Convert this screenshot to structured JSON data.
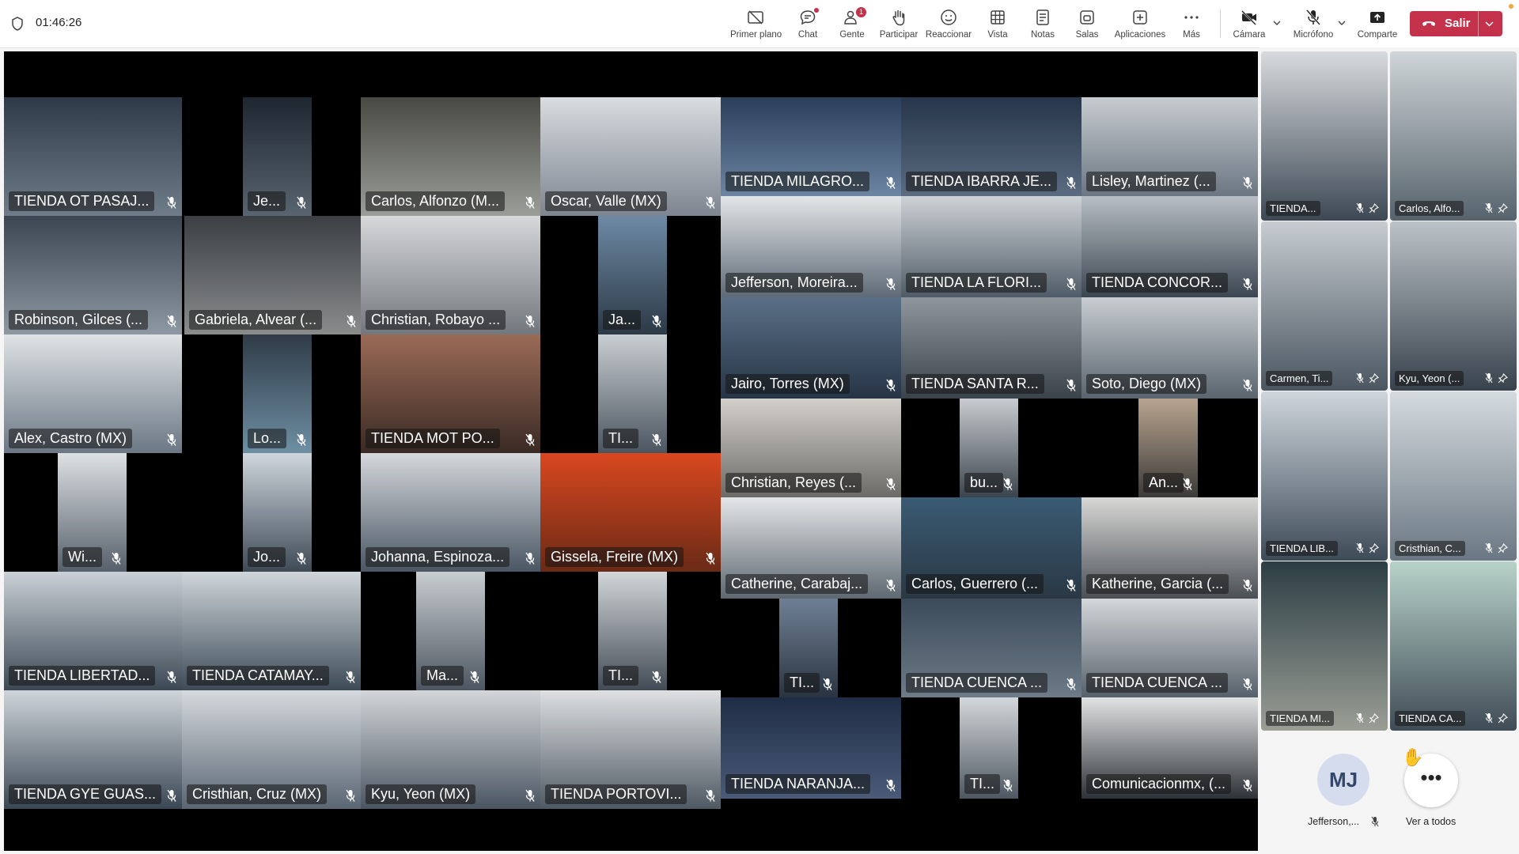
{
  "meeting": {
    "elapsed_time": "01:46:26"
  },
  "toolbar": {
    "items": [
      {
        "label": "Primer plano",
        "icon": "spotlight-icon"
      },
      {
        "label": "Chat",
        "icon": "chat-icon"
      },
      {
        "label": "Gente",
        "icon": "people-icon",
        "badge": "1"
      },
      {
        "label": "Participar",
        "icon": "raise-hand-icon"
      },
      {
        "label": "Reaccionar",
        "icon": "smiley-icon"
      },
      {
        "label": "Vista",
        "icon": "grid-view-icon"
      },
      {
        "label": "Notas",
        "icon": "notes-icon"
      },
      {
        "label": "Salas",
        "icon": "rooms-icon"
      },
      {
        "label": "Aplicaciones",
        "icon": "apps-icon"
      },
      {
        "label": "Más",
        "icon": "more-icon"
      }
    ],
    "camera_label": "Cámara",
    "mic_label": "Micrófono",
    "share_label": "Comparte",
    "leave_label": "Salir"
  },
  "grid": [
    "TIENDA OT PASAJ...",
    "Je...",
    "Carlos, Alfonzo (M...",
    "Oscar, Valle (MX)",
    "TIENDA MILAGRO...",
    "TIENDA IBARRA JE...",
    "Lisley, Martinez (...",
    "Robinson, Gilces (...",
    "Gabriela, Alvear (...",
    "Christian, Robayo ...",
    "Ja...",
    "Jefferson, Moreira...",
    "TIENDA LA FLORI...",
    "TIENDA CONCOR...",
    "Alex, Castro (MX)",
    "Lo...",
    "TIENDA MOT PO...",
    "TI...",
    "Jairo, Torres (MX)",
    "TIENDA SANTA R...",
    "Soto, Diego (MX)",
    "Wi...",
    "Jo...",
    "Johanna, Espinoza...",
    "Gissela, Freire (MX)",
    "Christian, Reyes (...",
    "bu...",
    "An...",
    "Catherine, Carabaj...",
    "Carlos, Guerrero (...",
    "Katherine, Garcia (...",
    "TIENDA LIBERTAD...",
    "TIENDA CATAMAY...",
    "Ma...",
    "TI...",
    "TI...",
    "TIENDA CUENCA ...",
    "TIENDA CUENCA ...",
    "TIENDA GYE GUAS...",
    "Cristhian, Cruz (MX)",
    "Kyu, Yeon (MX)",
    "TIENDA PORTOVI...",
    "TIENDA NARANJA...",
    "TI...",
    "Comunicacionmx, (..."
  ],
  "sidebar": {
    "tiles": [
      "TIENDA...",
      "Carlos, Alfo...",
      "Carmen, Ti...",
      "Kyu, Yeon (...",
      "TIENDA LIB...",
      "Cristhian, C...",
      "TIENDA MI...",
      "TIENDA CA..."
    ],
    "avatar_initials": "MJ",
    "avatar_name": "Jefferson,...",
    "see_all_label": "Ver a todos"
  },
  "colors": {
    "leave_button": "#c4314b",
    "notification": "#c4314b",
    "avatar_bg": "#d4dced",
    "stage_bg": "#000000"
  }
}
